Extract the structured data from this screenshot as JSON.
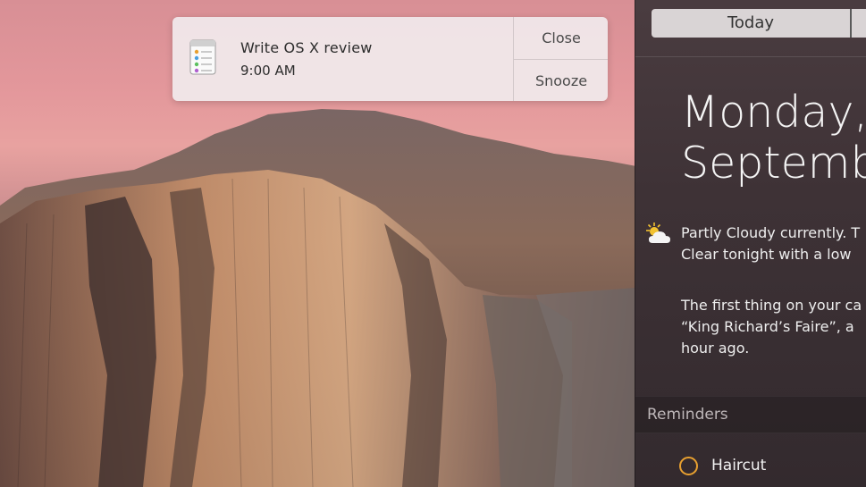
{
  "colors": {
    "panel_bg": "#3e3236",
    "banner_bg": "#f0e8ea",
    "reminder_accent": "#e8a030",
    "sky_pink": "#e3979b"
  },
  "banner": {
    "icon": "reminders-app-icon",
    "title": "Write OS X review",
    "time": "9:00 AM",
    "close_label": "Close",
    "snooze_label": "Snooze"
  },
  "notification_center": {
    "tabs": {
      "today_label": "Today"
    },
    "date": {
      "day": "Monday,",
      "month": "Septembe"
    },
    "weather": {
      "icon": "partly-cloudy-icon",
      "line1": "Partly Cloudy currently. T",
      "line2": "Clear tonight with a low"
    },
    "calendar": {
      "line1": "The first thing on your ca",
      "line2": "“King Richard’s Faire”, a",
      "line3": "hour ago."
    },
    "reminders": {
      "section_label": "Reminders",
      "items": [
        {
          "label": "Haircut"
        }
      ]
    }
  }
}
